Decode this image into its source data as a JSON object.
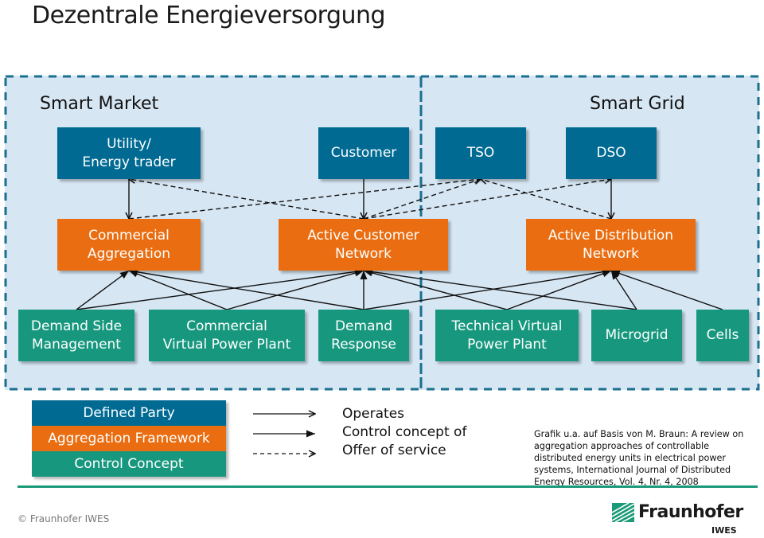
{
  "title": "Dezentrale Energieversorgung",
  "zones": {
    "smart_market": "Smart Market",
    "smart_grid": "Smart Grid"
  },
  "colors": {
    "defined_party": "#006a93",
    "aggregation_framework": "#ea6e11",
    "control_concept": "#17987e",
    "zone_background": "#d6e6f3",
    "zone_border": "#1b6f8f",
    "rule": "#1a9a78"
  },
  "defined_parties": [
    {
      "id": "utility",
      "label": "Utility/\nEnergy trader"
    },
    {
      "id": "customer",
      "label": "Customer"
    },
    {
      "id": "tso",
      "label": "TSO"
    },
    {
      "id": "dso",
      "label": "DSO"
    }
  ],
  "aggregation_frameworks": [
    {
      "id": "commercial_aggregation",
      "label": "Commercial\nAggregation"
    },
    {
      "id": "active_customer_network",
      "label": "Active Customer\nNetwork"
    },
    {
      "id": "active_distribution_network",
      "label": "Active Distribution\nNetwork"
    }
  ],
  "control_concepts": [
    {
      "id": "dsm",
      "label": "Demand Side\nManagement"
    },
    {
      "id": "cvpp",
      "label": "Commercial\nVirtual Power Plant"
    },
    {
      "id": "dr",
      "label": "Demand\nResponse"
    },
    {
      "id": "tvpp",
      "label": "Technical Virtual\nPower Plant"
    },
    {
      "id": "microgrid",
      "label": "Microgrid"
    },
    {
      "id": "cells",
      "label": "Cells"
    }
  ],
  "relations": {
    "operates": [
      {
        "from": "utility",
        "to": "commercial_aggregation"
      },
      {
        "from": "customer",
        "to": "active_customer_network"
      },
      {
        "from": "dso",
        "to": "active_distribution_network"
      }
    ],
    "offer_of_service": [
      {
        "from": "active_customer_network",
        "to": "utility"
      },
      {
        "from": "commercial_aggregation",
        "to": "tso"
      },
      {
        "from": "active_customer_network",
        "to": "tso"
      },
      {
        "from": "active_customer_network",
        "to": "dso"
      },
      {
        "from": "active_distribution_network",
        "to": "tso"
      }
    ],
    "control_concept_of": [
      {
        "from": "dsm",
        "to": "commercial_aggregation"
      },
      {
        "from": "dsm",
        "to": "active_customer_network"
      },
      {
        "from": "cvpp",
        "to": "commercial_aggregation"
      },
      {
        "from": "cvpp",
        "to": "active_customer_network"
      },
      {
        "from": "dr",
        "to": "commercial_aggregation"
      },
      {
        "from": "dr",
        "to": "active_customer_network"
      },
      {
        "from": "dr",
        "to": "active_distribution_network"
      },
      {
        "from": "tvpp",
        "to": "active_customer_network"
      },
      {
        "from": "tvpp",
        "to": "active_distribution_network"
      },
      {
        "from": "microgrid",
        "to": "active_customer_network"
      },
      {
        "from": "microgrid",
        "to": "active_distribution_network"
      },
      {
        "from": "cells",
        "to": "active_distribution_network"
      }
    ]
  },
  "legend": {
    "stack": [
      "Defined Party",
      "Aggregation Framework",
      "Control Concept"
    ],
    "arrows": [
      "Operates",
      "Control concept of",
      "Offer of service"
    ]
  },
  "citation": "Grafik u.a. auf Basis von M. Braun: A review on aggregation approaches of controllable distributed energy units in electrical power systems,  International Journal of Distributed Energy Resources, Vol. 4, Nr. 4, 2008",
  "footer": {
    "copyright": "© Fraunhofer IWES",
    "logo_name": "Fraunhofer",
    "logo_sub": "IWES"
  }
}
